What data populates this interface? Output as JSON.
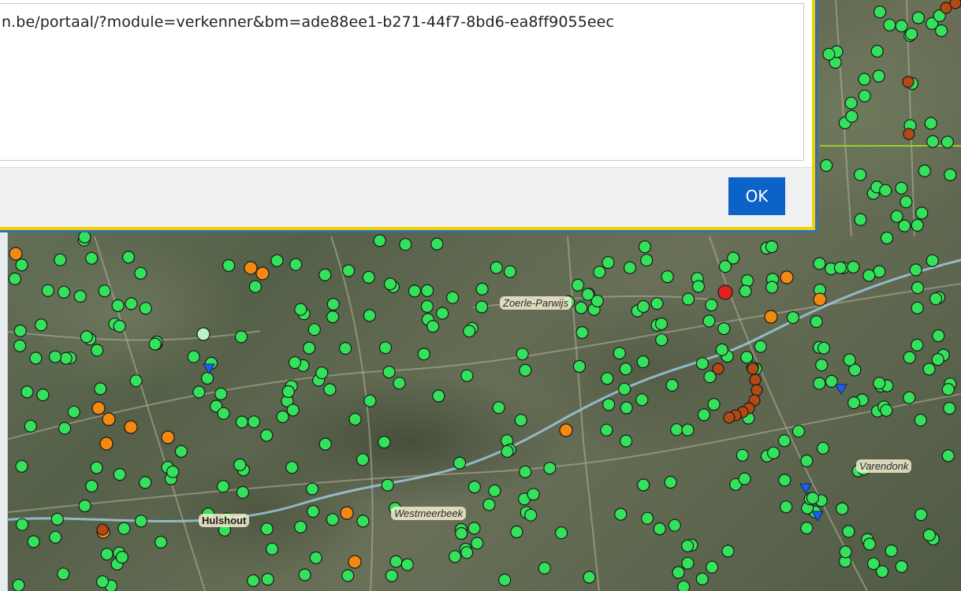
{
  "dialog": {
    "url_text": "n.be/portaal/?module=verkenner&bm=ade88ee1-b271-44f7-8bd6-ea8ff9055eec",
    "ok_label": "OK"
  },
  "map": {
    "place_labels": [
      "Hulshout",
      "Zoerle-Parwijs",
      "Westmeerbeek",
      "Varendonk"
    ],
    "colors": {
      "green_marker": "#33e25a",
      "orange_marker": "#f28a12",
      "brown_marker": "#b24a14",
      "red_marker": "#e0201c",
      "blue_marker": "#1f5ef0"
    }
  }
}
